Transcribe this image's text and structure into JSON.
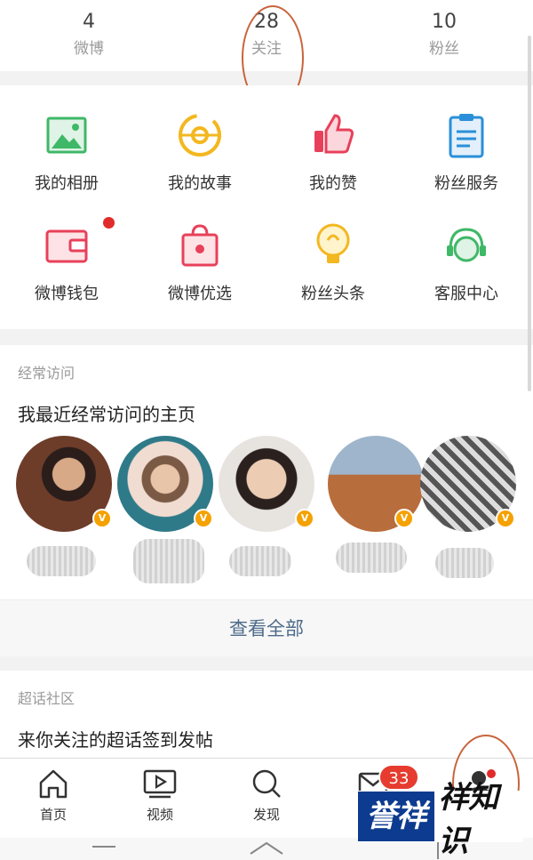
{
  "stats": [
    {
      "value": "4",
      "label": "微博"
    },
    {
      "value": "28",
      "label": "关注"
    },
    {
      "value": "10",
      "label": "粉丝"
    }
  ],
  "grid": [
    {
      "label": "我的相册",
      "icon": "photo-album-icon"
    },
    {
      "label": "我的故事",
      "icon": "story-icon"
    },
    {
      "label": "我的赞",
      "icon": "thumbs-up-icon"
    },
    {
      "label": "粉丝服务",
      "icon": "clipboard-icon"
    },
    {
      "label": "微博钱包",
      "icon": "wallet-icon",
      "dot": true
    },
    {
      "label": "微博优选",
      "icon": "shopping-bag-icon"
    },
    {
      "label": "粉丝头条",
      "icon": "lightbulb-icon"
    },
    {
      "label": "客服中心",
      "icon": "headset-icon"
    }
  ],
  "frequent": {
    "title": "经常访问",
    "subtitle": "我最近经常访问的主页",
    "see_all": "查看全部"
  },
  "community": {
    "title": "超话社区",
    "subtitle": "来你关注的超话签到发帖"
  },
  "tabbar": [
    {
      "label": "首页",
      "icon": "home-icon"
    },
    {
      "label": "视频",
      "icon": "video-icon"
    },
    {
      "label": "发现",
      "icon": "search-icon"
    },
    {
      "label": "",
      "icon": "mail-icon",
      "badge": "33"
    },
    {
      "label": "",
      "icon": "profile-icon"
    }
  ],
  "watermark": {
    "part1": "誉祥",
    "part2": "祥知识"
  },
  "colors": {
    "accent": "#e63b2e",
    "link": "#4d6a8a",
    "annotation": "#c8643c",
    "watermark_blue": "#0d3b8f"
  }
}
